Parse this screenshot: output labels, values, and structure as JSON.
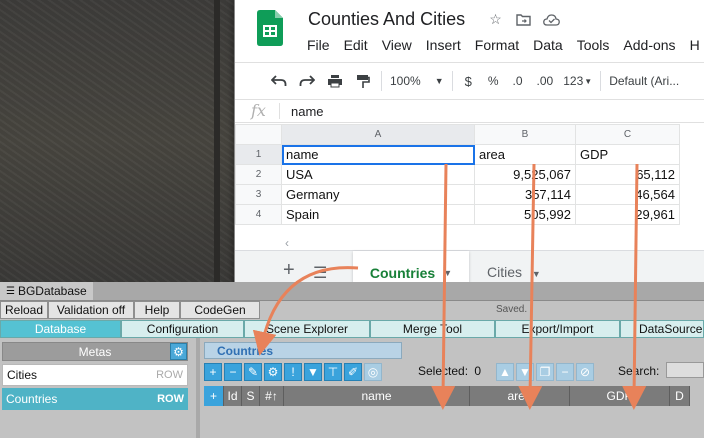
{
  "sheets": {
    "doc_title": "Counties And Cities",
    "menu": [
      "File",
      "Edit",
      "View",
      "Insert",
      "Format",
      "Data",
      "Tools",
      "Add-ons",
      "H"
    ],
    "toolbar": {
      "zoom": "100%",
      "currency": "$",
      "percent": "%",
      "dec_less": ".0",
      "dec_more": ".00",
      "format_more": "123",
      "font": "Default (Ari..."
    },
    "formula_bar": {
      "fx_label": "fx",
      "value": "name"
    },
    "columns": [
      "A",
      "B",
      "C"
    ],
    "rows": [
      {
        "n": "1",
        "a": "name",
        "b": "area",
        "c": "GDP"
      },
      {
        "n": "2",
        "a": "USA",
        "b": "9,525,067",
        "c": "65,112"
      },
      {
        "n": "3",
        "a": "Germany",
        "b": "357,114",
        "c": "46,564"
      },
      {
        "n": "4",
        "a": "Spain",
        "b": "505,992",
        "c": "29,961"
      }
    ],
    "sheet_tabs": {
      "active": "Countries",
      "other": "Cities"
    }
  },
  "bgdatabase": {
    "window_title": "BGDatabase",
    "buttons": [
      "Reload",
      "Validation off",
      "Help",
      "CodeGen"
    ],
    "status": "Saved.",
    "tabs": [
      "Database",
      "Configuration",
      "Scene Explorer",
      "Merge Tool",
      "Export/Import",
      "DataSource"
    ],
    "metas_header": "Metas",
    "metas": [
      {
        "name": "Cities",
        "tag": "ROW",
        "selected": false
      },
      {
        "name": "Countries",
        "tag": "ROW",
        "selected": true
      }
    ],
    "table_tab": "Countries",
    "selected_label": "Selected:",
    "selected_count": "0",
    "search_label": "Search:",
    "columns": [
      "Id",
      "S",
      "#↑",
      "name",
      "area",
      "GDP",
      "D"
    ]
  },
  "colors": {
    "sheets_green": "#188038",
    "selection_blue": "#1a73e8",
    "arrow_orange": "#e8825a",
    "bg_active_tab": "#55c2d3",
    "bg_tool_blue": "#3aa3dc"
  }
}
